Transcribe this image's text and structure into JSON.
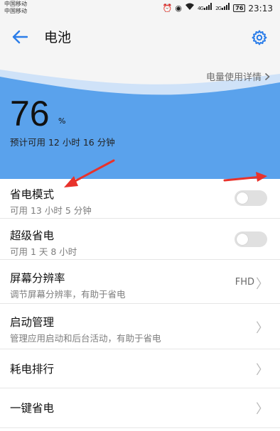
{
  "statusbar": {
    "carriers": [
      "中国移动",
      "中国移动"
    ],
    "signal_labels": [
      "4G",
      "2G"
    ],
    "battery": "76",
    "time": "23:13",
    "icons": [
      "alarm-icon",
      "eye-icon",
      "wifi-icon",
      "signal-icon",
      "signal-icon",
      "battery-icon"
    ]
  },
  "header": {
    "back_icon": "arrow-left-icon",
    "title": "电池",
    "settings_icon": "gear-icon"
  },
  "battery_card": {
    "usage_details_label": "电量使用详情",
    "level": "76",
    "unit": "%",
    "remaining": "预计可用 12 小时 16 分钟"
  },
  "settings": [
    {
      "title": "省电模式",
      "subtitle": "可用 13 小时 5 分钟",
      "control": "toggle",
      "state": "off"
    },
    {
      "title": "超级省电",
      "subtitle": "可用 1 天 8 小时",
      "control": "toggle",
      "state": "off"
    },
    {
      "title": "屏幕分辨率",
      "subtitle": "调节屏幕分辨率，有助于省电",
      "value": "FHD",
      "control": "chevron"
    },
    {
      "title": "启动管理",
      "subtitle": "管理应用启动和后台活动，有助于省电",
      "control": "chevron"
    },
    {
      "title": "耗电排行",
      "control": "chevron"
    },
    {
      "title": "一键省电",
      "control": "chevron"
    }
  ],
  "colors": {
    "accent": "#2b7de9",
    "wave_blue": "#5aa2ec",
    "background": "#f5f5f5",
    "annotation_red": "#e8322b"
  }
}
